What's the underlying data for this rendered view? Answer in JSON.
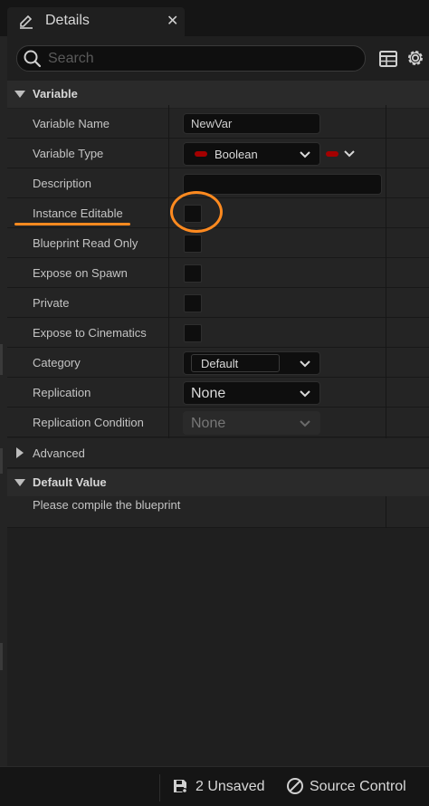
{
  "tab": {
    "title": "Details",
    "close": "✕"
  },
  "search": {
    "placeholder": "Search",
    "value": ""
  },
  "sections": {
    "variable": "Variable",
    "advanced": "Advanced",
    "default_value": "Default Value"
  },
  "rows": {
    "variable_name": {
      "label": "Variable Name",
      "value": "NewVar"
    },
    "variable_type": {
      "label": "Variable Type",
      "value": "Boolean"
    },
    "description": {
      "label": "Description",
      "value": ""
    },
    "instance_editable": {
      "label": "Instance Editable",
      "checked": false
    },
    "blueprint_read_only": {
      "label": "Blueprint Read Only",
      "checked": false
    },
    "expose_on_spawn": {
      "label": "Expose on Spawn",
      "checked": false
    },
    "private": {
      "label": "Private",
      "checked": false
    },
    "expose_to_cinematics": {
      "label": "Expose to Cinematics",
      "checked": false
    },
    "category": {
      "label": "Category",
      "value": "Default"
    },
    "replication": {
      "label": "Replication",
      "value": "None"
    },
    "replication_condition": {
      "label": "Replication Condition",
      "value": "None"
    }
  },
  "default_value_message": "Please compile the blueprint",
  "statusbar": {
    "unsaved": "2 Unsaved",
    "source_control": "Source Control"
  },
  "colors": {
    "accent_highlight": "#ff8a1f",
    "boolean_pin": "#a40000",
    "panel_bg": "#1f1f1f"
  }
}
